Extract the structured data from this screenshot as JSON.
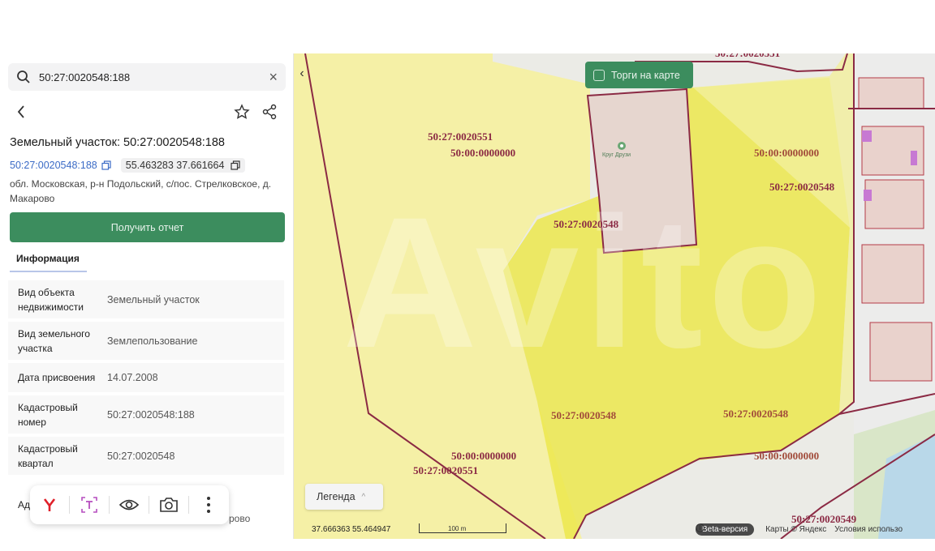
{
  "search": {
    "value": "50:27:0020548:188"
  },
  "parcel": {
    "title": "Земельный участок: 50:27:0020548:188",
    "cadastral_link": "50:27:0020548:188",
    "coordinates": "55.463283 37.661664",
    "address": "обл. Московская, р-н Подольский, с/пос. Стрелковское, д. Макарово"
  },
  "buttons": {
    "report": "Получить отчет",
    "torgi": "Торги на карте",
    "legend": "Легенда"
  },
  "tabs": {
    "info": "Информация"
  },
  "info_rows": [
    {
      "label": "Вид объекта недвижимости",
      "value": "Земельный участок"
    },
    {
      "label": "Вид земельного участка",
      "value": "Землепользование"
    },
    {
      "label": "Дата присвоения",
      "value": "14.07.2008"
    },
    {
      "label": "Кадастровый номер",
      "value": "50:27:0020548:188"
    },
    {
      "label": "Кадастровый квартал",
      "value": "50:27:0020548"
    }
  ],
  "peek": {
    "label": "Ад",
    "value": "рово"
  },
  "map": {
    "labels": [
      "50:27:0020551",
      "50:00:0000000",
      "50:27:0020548",
      "50:00:0000000",
      "50:27:0020548",
      "50:27:0020548",
      "50:27:0020548",
      "50:00:0000000",
      "50:27:0020551",
      "50:00:0000000",
      "50:27:0020549",
      "50:27:0020551"
    ],
    "poi": "Круг Друзи",
    "coords_readout": "37.666363  55.464947",
    "scale": "100 m",
    "beta": "Beta-версия",
    "attribution_maps": "Карты © Яндекс",
    "attribution_terms": "Условия использо",
    "watermark": "Avito"
  },
  "colors": {
    "accent_green": "#3c8d5e",
    "parcel_yellow": "#f5f0a0",
    "highlight_yellow": "#ece84c",
    "boundary": "#8b2a44",
    "link_blue": "#3b6bc6"
  },
  "icons": [
    "search-icon",
    "clear-icon",
    "back-icon",
    "star-icon",
    "share-icon",
    "copy-icon",
    "yandex-icon",
    "text-scan-icon",
    "eye-icon",
    "camera-icon",
    "more-icon",
    "info-icon",
    "chevron-up-icon",
    "chevron-left-icon"
  ]
}
